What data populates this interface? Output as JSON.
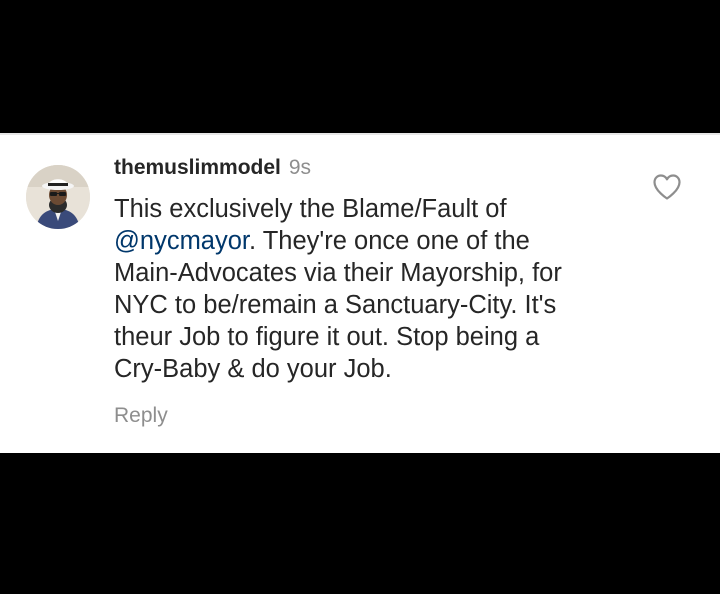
{
  "comment": {
    "username": "themuslimmodel",
    "timestamp": "9s",
    "text_before_mention": "This exclusively the Blame/Fault of\n",
    "mention": "@nycmayor",
    "text_after_mention": ". They're once one of the\nMain-Advocates via their Mayorship, for\nNYC to be/remain a Sanctuary-City. It's\ntheur Job to figure it out. Stop being a\nCry-Baby & do your Job.",
    "reply_label": "Reply",
    "like_icon": "heart-outline-icon"
  },
  "colors": {
    "text": "#262626",
    "secondary": "#8e8e8e",
    "mention": "#00376b",
    "background": "#ffffff",
    "frame": "#000000"
  }
}
